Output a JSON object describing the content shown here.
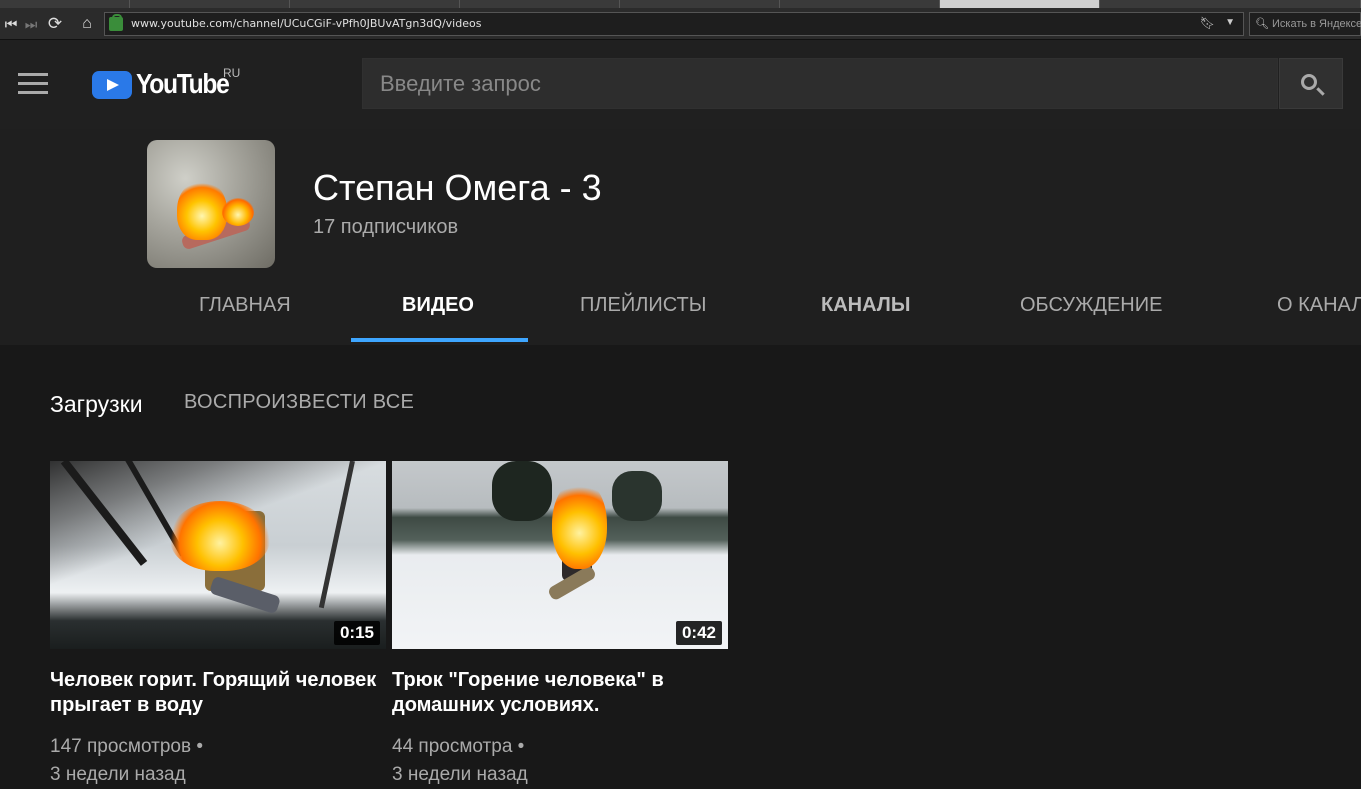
{
  "browser": {
    "url": "www.youtube.com/channel/UCuCGiF-vPfh0JBUvATgn3dQ/videos",
    "search_placeholder": "Искать в Яндексе"
  },
  "header": {
    "logo_text": "YouTube",
    "logo_region": "RU",
    "search_placeholder": "Введите запрос"
  },
  "channel": {
    "name": "Степан Омега - 3",
    "subscribers": "17 подписчиков",
    "tabs": [
      {
        "label": "ГЛАВНАЯ"
      },
      {
        "label": "ВИДЕО"
      },
      {
        "label": "ПЛЕЙЛИСТЫ"
      },
      {
        "label": "КАНАЛЫ"
      },
      {
        "label": "ОБСУЖДЕНИЕ"
      },
      {
        "label": "О КАНАЛЕ"
      }
    ],
    "active_tab": "ВИДЕО",
    "accent_color": "#3ea6ff"
  },
  "shelf": {
    "title": "Загрузки",
    "play_all": "ВОСПРОИЗВЕСТИ ВСЕ"
  },
  "videos": [
    {
      "title": "Человек горит. Горящий человек прыгает в воду",
      "duration": "0:15",
      "views": "147 просмотров •",
      "age": "3 недели назад"
    },
    {
      "title": "Трюк \"Горение человека\" в домашних условиях.",
      "duration": "0:42",
      "views": "44 просмотра •",
      "age": "3 недели назад"
    }
  ]
}
